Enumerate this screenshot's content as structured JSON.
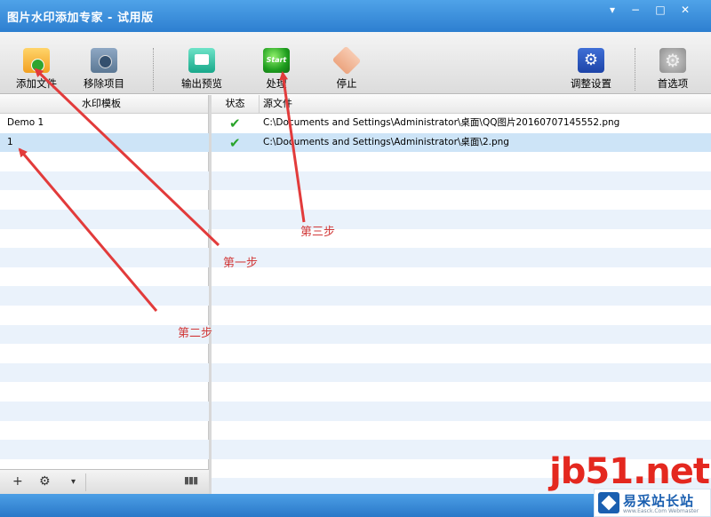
{
  "window": {
    "title": "图片水印添加专家 - 试用版",
    "controls": [
      "▾",
      "−",
      "□",
      "✕"
    ]
  },
  "toolbar": {
    "add_file": "添加文件",
    "remove_item": "移除项目",
    "output_preview": "输出预览",
    "process": "处理",
    "start_icon_text": "Start",
    "stop": "停止",
    "adjust_settings": "调整设置",
    "preferences": "首选项"
  },
  "templates_panel": {
    "header": "水印模板",
    "items": [
      "Demo 1",
      "1"
    ],
    "selected_index": 1,
    "footer": {
      "add": "+",
      "settings": "⚙",
      "dropdown": "▾",
      "columns": "▮▮▮"
    }
  },
  "files_panel": {
    "headers": {
      "status": "状态",
      "source": "源文件"
    },
    "rows": [
      {
        "status": "✔",
        "path": "C:\\Documents and Settings\\Administrator\\桌面\\QQ图片20160707145552.png"
      },
      {
        "status": "✔",
        "path": "C:\\Documents and Settings\\Administrator\\桌面\\2.png"
      }
    ],
    "selected_index": 1
  },
  "annotations": {
    "step1": "第一步",
    "step2": "第二步",
    "step3": "第三步",
    "color": "#e23b3b"
  },
  "watermark": {
    "site": "jb51.net",
    "brand_cn": "易采站长站",
    "brand_en": "www.Easck.Com Webmaster"
  },
  "colors": {
    "titlebar": "#2d7fd0",
    "selection": "#cde4f7",
    "alt_row": "#eaf2fb",
    "check": "#29a32b"
  }
}
